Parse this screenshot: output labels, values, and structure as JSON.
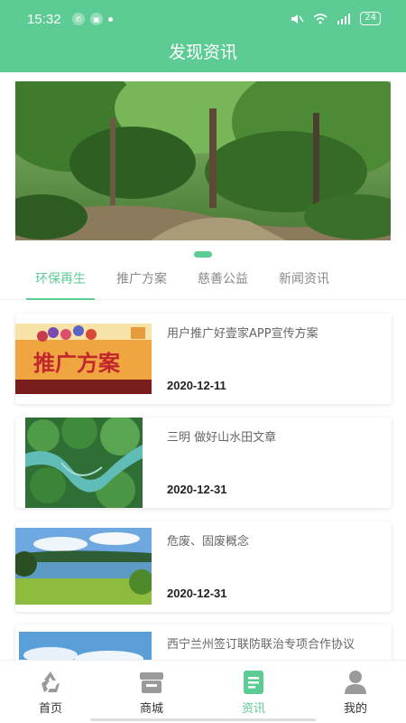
{
  "status_bar": {
    "time": "15:32",
    "battery": "24"
  },
  "header": {
    "title": "发现资讯"
  },
  "tabs": [
    {
      "label": "环保再生",
      "active": true
    },
    {
      "label": "推广方案",
      "active": false
    },
    {
      "label": "慈善公益",
      "active": false
    },
    {
      "label": "新闻资讯",
      "active": false
    }
  ],
  "articles": [
    {
      "title": "用户推广好壹家APP宣传方案",
      "date": "2020-12-11",
      "thumb_text": "推广方案"
    },
    {
      "title": "三明 做好山水田文章",
      "date": "2020-12-31"
    },
    {
      "title": "危废、固废概念",
      "date": "2020-12-31"
    },
    {
      "title": "西宁兰州签订联防联治专项合作协议",
      "date": ""
    }
  ],
  "bottom_nav": [
    {
      "label": "首页",
      "icon": "recycle-icon"
    },
    {
      "label": "商城",
      "icon": "store-icon"
    },
    {
      "label": "资讯",
      "icon": "news-icon",
      "active": true
    },
    {
      "label": "我的",
      "icon": "user-icon"
    }
  ],
  "colors": {
    "accent": "#5ccb94",
    "text_dark": "#222222",
    "text_muted": "#888888"
  }
}
